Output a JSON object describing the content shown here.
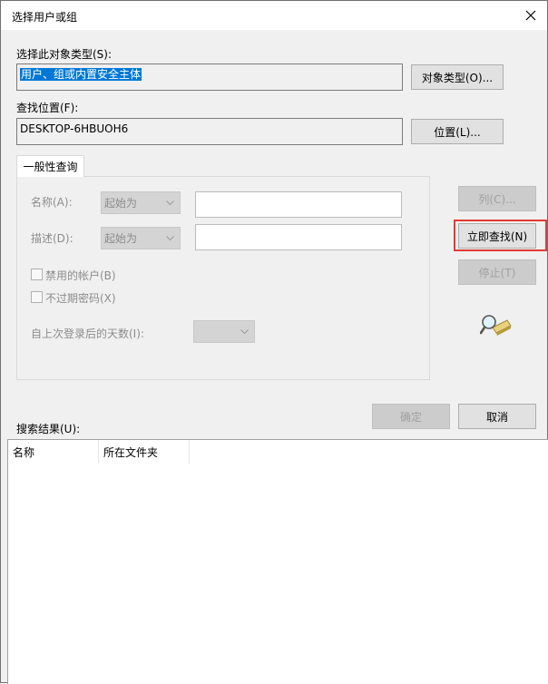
{
  "window": {
    "title": "选择用户或组"
  },
  "object_type": {
    "label": "选择此对象类型(S):",
    "value": "用户、组或内置安全主体",
    "button": "对象类型(O)..."
  },
  "location": {
    "label": "查找位置(F):",
    "value": "DESKTOP-6HBUOH6",
    "button": "位置(L)..."
  },
  "tab": {
    "label": "一般性查询"
  },
  "query": {
    "name_label": "名称(A):",
    "name_mode": "起始为",
    "desc_label": "描述(D):",
    "desc_mode": "起始为",
    "disabled_accounts": "禁用的帐户(B)",
    "no_expire_password": "不过期密码(X)",
    "days_since_login_label": "自上次登录后的天数(I):"
  },
  "side_buttons": {
    "columns": "列(C)...",
    "find_now": "立即查找(N)",
    "stop": "停止(T)"
  },
  "footer": {
    "ok": "确定",
    "cancel": "取消"
  },
  "results": {
    "label": "搜索结果(U):",
    "columns": [
      "名称",
      "所在文件夹"
    ]
  },
  "colors": {
    "selection": "#0078d7",
    "highlight": "#e53935",
    "dialog_bg": "#f0f0f0"
  }
}
